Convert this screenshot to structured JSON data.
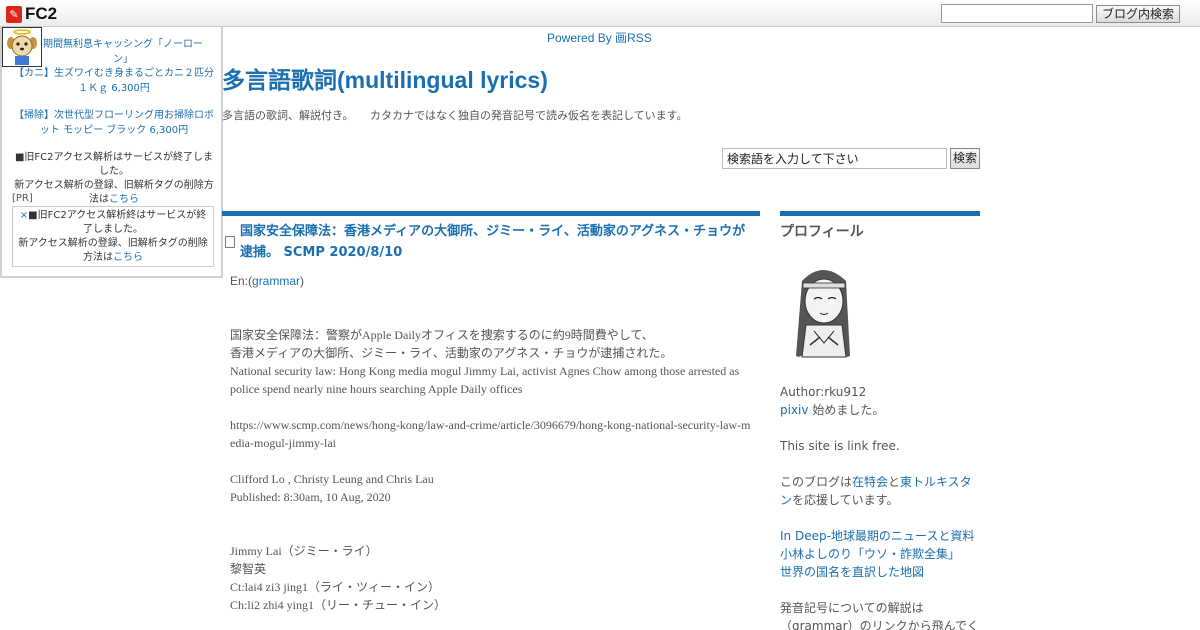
{
  "fc2bar": {
    "logo_text": "FC2",
    "search_value": "",
    "search_button": "ブログ内検索"
  },
  "ads": {
    "item1": "期間無利息キャッシング「ノーローン」",
    "item2": "【カニ】生ズワイむき身まるごとカニ２匹分１Ｋｇ 6,300円",
    "item3": "【掃除】次世代型フローリング用お掃除ロボット モッピー ブラック 6,300円",
    "notice1_line1": "■旧FC2アクセス解析はサービスが終了しました。",
    "notice1_line2": "新アクセス解析の登録、旧解析タグの削除方法は",
    "notice1_link": "こちら",
    "pr_label": "[PR]",
    "notice2_close": "×",
    "notice2_line1": "■旧FC2アクセス解析終はサービスが終了しました。",
    "notice2_line2": "新アクセス解析の登録、旧解析タグの削除方法は",
    "notice2_link": "こちら"
  },
  "header": {
    "powered_by": "Powered By 画RSS",
    "blog_title": "多言語歌詞(multilingual lyrics)",
    "blog_description": "多言語の歌詞、解説付き。　　カタカナではなく独自の発音記号で読み仮名を表記しています。",
    "search_value": "検索語を入力して下さい",
    "search_button": "検索"
  },
  "entry": {
    "title": "国家安全保障法：香港メディアの大御所、ジミー・ライ、活動家のアグネス・チョウが逮捕。 SCMP 2020/8/10",
    "en_prefix": "En:(",
    "en_link": "grammar",
    "en_suffix": ")",
    "para1_line1": "国家安全保障法：警察がApple Dailyオフィスを捜索するのに約9時間費やして、",
    "para1_line2": "香港メディアの大御所、ジミー・ライ、活動家のアグネス・チョウが逮捕された。",
    "para1_line3": "National security law: Hong Kong media mogul Jimmy Lai, activist Agnes Chow among those arrested as police spend nearly nine hours searching Apple Daily offices",
    "url": "https://www.scmp.com/news/hong-kong/law-and-crime/article/3096679/hong-kong-national-security-law-media-mogul-jimmy-lai",
    "authors": "Clifford Lo , Christy Leung and Chris Lau",
    "published": "Published: 8:30am, 10 Aug, 2020",
    "name_line1": "Jimmy Lai（ジミー・ライ）",
    "name_line2": "黎智英",
    "name_line3": "Ct:lai4 zi3 jing1（ライ・ツィー・イン）",
    "name_line4": "Ch:li2 zhi4 ying1（リー・チュー・イン）"
  },
  "sidebar": {
    "profile_title": "プロフィール",
    "author": "Author:rku912",
    "pixiv_link": "pixiv",
    "pixiv_suffix": " 始めました。",
    "link_free": "This site is link free.",
    "support_prefix": "このブログは",
    "support_link1": "在特会",
    "support_mid": "と",
    "support_link2": "東トルキスタン",
    "support_suffix": "を応援しています。",
    "link1": "In Deep-地球最期のニュースと資料",
    "link2": "小林よしのり「ウソ・詐欺全集」",
    "link3": "世界の国名を直訳した地図",
    "note_line1": "発音記号についての解説は",
    "note_line2": "（grammar）のリンクから飛んでく"
  },
  "colors": {
    "accent": "#1a6fb0",
    "text": "#555555",
    "fc2_red": "#e0261c"
  }
}
